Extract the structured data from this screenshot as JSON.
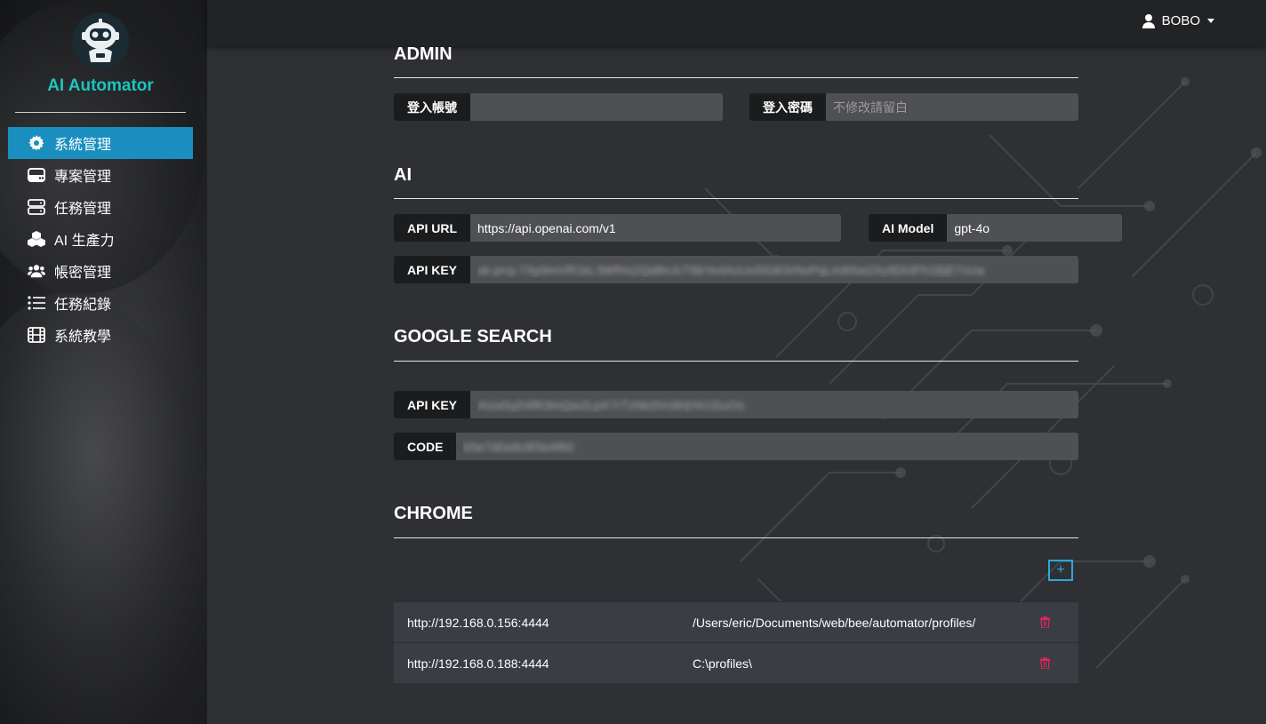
{
  "app": {
    "brand": "AI Automator"
  },
  "sidebar": {
    "items": [
      {
        "label": "系統管理",
        "icon": "gear-icon",
        "active": true
      },
      {
        "label": "專案管理",
        "icon": "drive-icon",
        "active": false
      },
      {
        "label": "任務管理",
        "icon": "server-icon",
        "active": false
      },
      {
        "label": "AI 生產力",
        "icon": "cubes-icon",
        "active": false
      },
      {
        "label": "帳密管理",
        "icon": "users-icon",
        "active": false
      },
      {
        "label": "任務紀錄",
        "icon": "list-icon",
        "active": false
      },
      {
        "label": "系統教學",
        "icon": "film-icon",
        "active": false
      }
    ]
  },
  "topbar": {
    "user": "BOBO",
    "user_icon": "user-icon"
  },
  "admin": {
    "title": "ADMIN",
    "account_label": "登入帳號",
    "account_value": "",
    "password_label": "登入密碼",
    "password_placeholder": "不修改請留白"
  },
  "ai": {
    "title": "AI",
    "api_url_label": "API URL",
    "api_url_value": "https://api.openai.com/v1",
    "model_label": "AI Model",
    "model_value": "gpt-4o",
    "api_key_label": "API KEY",
    "api_key_value": "sk-proj-7Xp9mVR1kL3WfHs2Qd8nJcT6bYe4AzUo5GiK0rNvPqLm8Sw2Xy9Dt3Fh1BjE7cUa"
  },
  "google": {
    "title": "GOOGLE SEARCH",
    "api_key_label": "API KEY",
    "api_key_value": "AIzaSyD4fK9mQw2LpX7rTzNb3Vc8HjYe1GuOs",
    "code_label": "CODE",
    "code_value": "b5e7d0a9c8f3e4f60"
  },
  "chrome": {
    "title": "CHROME",
    "add_label": "+",
    "rows": [
      {
        "url": "http://192.168.0.156:4444",
        "path": "/Users/eric/Documents/web/bee/automator/profiles/"
      },
      {
        "url": "http://192.168.0.188:4444",
        "path": "C:\\profiles\\"
      }
    ]
  },
  "colors": {
    "accent": "#1a8fbf",
    "brand": "#1ec3bd",
    "delete": "#e0245e"
  }
}
